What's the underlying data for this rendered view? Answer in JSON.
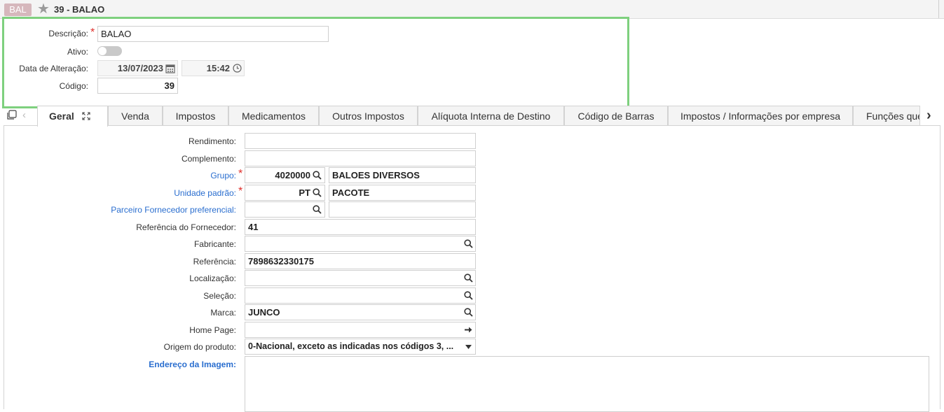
{
  "window": {
    "abbr": "BAL",
    "title": "39 - BALAO"
  },
  "header": {
    "descricao_label": "Descrição:",
    "descricao_value": "BALAO",
    "ativo_label": "Ativo:",
    "ativo_on": false,
    "data_label": "Data de Alteração:",
    "data_value": "13/07/2023",
    "hora_value": "15:42",
    "codigo_label": "Código:",
    "codigo_value": "39",
    "required_mark": "*"
  },
  "tabs": [
    {
      "label": "Geral",
      "active": true
    },
    {
      "label": "Venda"
    },
    {
      "label": "Impostos"
    },
    {
      "label": "Medicamentos"
    },
    {
      "label": "Outros Impostos"
    },
    {
      "label": "Alíquota Interna de Destino"
    },
    {
      "label": "Código de Barras"
    },
    {
      "label": "Impostos / Informações por empresa"
    },
    {
      "label": "Funções que"
    }
  ],
  "form": {
    "rendimento_label": "Rendimento:",
    "rendimento_value": "",
    "complemento_label": "Complemento:",
    "complemento_value": "",
    "grupo_label": "Grupo:",
    "grupo_code": "4020000",
    "grupo_desc": "BALOES DIVERSOS",
    "unidade_label": "Unidade padrão:",
    "unidade_code": "PT",
    "unidade_desc": "PACOTE",
    "parceiro_label": "Parceiro Fornecedor preferencial:",
    "parceiro_code": "",
    "parceiro_desc": "",
    "ref_fornecedor_label": "Referência do Fornecedor:",
    "ref_fornecedor_value": "41",
    "fabricante_label": "Fabricante:",
    "fabricante_value": "",
    "referencia_label": "Referência:",
    "referencia_value": "7898632330175",
    "localizacao_label": "Localização:",
    "localizacao_value": "",
    "selecao_label": "Seleção:",
    "selecao_value": "",
    "marca_label": "Marca:",
    "marca_value": "JUNCO",
    "homepage_label": "Home Page:",
    "homepage_value": "",
    "origem_label": "Origem do produto:",
    "origem_value": "0-Nacional, exceto as indicadas nos códigos 3, ...",
    "endereco_label": "Endereço da Imagem:",
    "endereco_value": ""
  },
  "icons": {
    "favorite": "star-icon",
    "calendar": "calendar-icon",
    "clock": "clock-icon",
    "search": "search-icon",
    "arrow": "arrow-right-icon",
    "dropdown": "caret-down-icon",
    "copy": "copy-icon",
    "expand": "expand-icon"
  },
  "colors": {
    "highlight": "#7ed07e",
    "required": "#e0302c",
    "link": "#2a6ecf",
    "abbr_bg": "#d6b7bc"
  }
}
